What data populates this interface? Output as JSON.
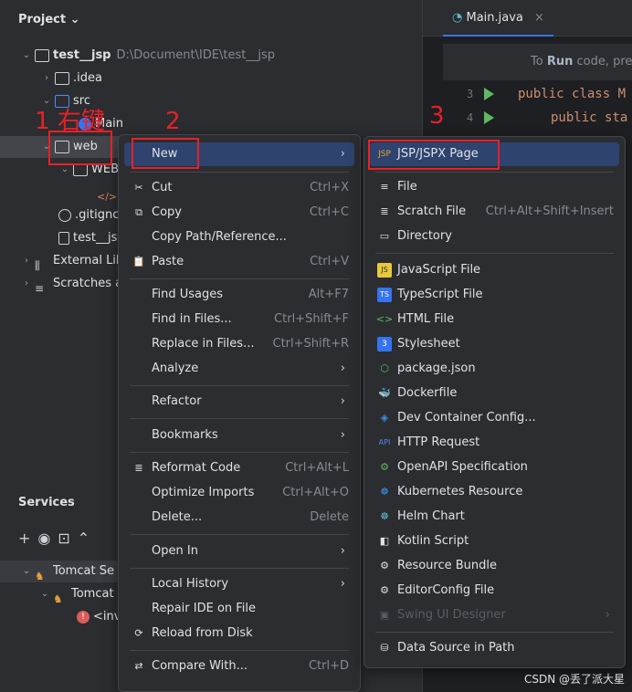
{
  "project": {
    "header": "Project",
    "root_name": "test__jsp",
    "root_path": "D:\\Document\\IDE\\test__jsp",
    "idea": ".idea",
    "src": "src",
    "main": "Main",
    "web": "web",
    "webinf": "WEB",
    "gitignore": ".gitignc",
    "iml": "test__js",
    "ext_libs": "External Lib",
    "scratches": "Scratches a"
  },
  "services": {
    "title": "Services",
    "tomcat_server": "Tomcat Se",
    "tomcat_child": "Tomcat",
    "inv": "<inv"
  },
  "editor": {
    "tab": "Main.java",
    "hint_prefix": "To",
    "hint_bold": "Run",
    "hint_suffix": "code, pre",
    "line3_num": "3",
    "line4_num": "4",
    "line3": "public class M",
    "line4": "public sta"
  },
  "annotations": {
    "one": "1",
    "one_label": "右键",
    "two": "2",
    "three": "3"
  },
  "context_menu": {
    "new": "New",
    "cut": "Cut",
    "cut_sc": "Ctrl+X",
    "copy": "Copy",
    "copy_sc": "Ctrl+C",
    "copy_path": "Copy Path/Reference...",
    "paste": "Paste",
    "paste_sc": "Ctrl+V",
    "find_usages": "Find Usages",
    "find_usages_sc": "Alt+F7",
    "find_in_files": "Find in Files...",
    "find_in_files_sc": "Ctrl+Shift+F",
    "replace_in_files": "Replace in Files...",
    "replace_in_files_sc": "Ctrl+Shift+R",
    "analyze": "Analyze",
    "refactor": "Refactor",
    "bookmarks": "Bookmarks",
    "reformat": "Reformat Code",
    "reformat_sc": "Ctrl+Alt+L",
    "optimize": "Optimize Imports",
    "optimize_sc": "Ctrl+Alt+O",
    "delete": "Delete...",
    "delete_sc": "Delete",
    "open_in": "Open In",
    "local_history": "Local History",
    "repair": "Repair IDE on File",
    "reload": "Reload from Disk",
    "compare": "Compare With...",
    "compare_sc": "Ctrl+D"
  },
  "new_menu": {
    "jsp": "JSP/JSPX Page",
    "file": "File",
    "scratch": "Scratch File",
    "scratch_sc": "Ctrl+Alt+Shift+Insert",
    "directory": "Directory",
    "js": "JavaScript File",
    "ts": "TypeScript File",
    "html": "HTML File",
    "css": "Stylesheet",
    "pkg": "package.json",
    "docker": "Dockerfile",
    "devcontainer": "Dev Container Config...",
    "http": "HTTP Request",
    "openapi": "OpenAPI Specification",
    "k8s": "Kubernetes Resource",
    "helm": "Helm Chart",
    "kotlin": "Kotlin Script",
    "bundle": "Resource Bundle",
    "editorconfig": "EditorConfig File",
    "swing": "Swing UI Designer",
    "datasource": "Data Source in Path"
  },
  "watermark": "CSDN @丢了派大星"
}
